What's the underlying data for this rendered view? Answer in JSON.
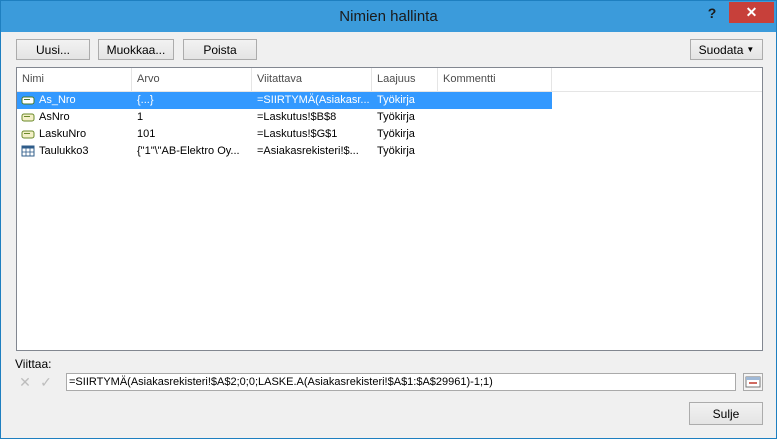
{
  "window": {
    "title": "Nimien hallinta",
    "help": "?",
    "close": "✕"
  },
  "toolbar": {
    "new": "Uusi...",
    "edit": "Muokkaa...",
    "delete": "Poista",
    "filter": "Suodata"
  },
  "table": {
    "columns": [
      "Nimi",
      "Arvo",
      "Viitattava",
      "Laajuus",
      "Kommentti"
    ],
    "rows": [
      {
        "name": "As_Nro",
        "value": "{...}",
        "ref": "=SIIRTYMÄ(Asiakasr...",
        "scope": "Työkirja",
        "comment": "",
        "icon": "named-range-icon"
      },
      {
        "name": "AsNro",
        "value": "1",
        "ref": "=Laskutus!$B$8",
        "scope": "Työkirja",
        "comment": "",
        "icon": "named-range-icon"
      },
      {
        "name": "LaskuNro",
        "value": "101",
        "ref": "=Laskutus!$G$1",
        "scope": "Työkirja",
        "comment": "",
        "icon": "named-range-icon"
      },
      {
        "name": "Taulukko3",
        "value": "{\"1\"\\\"AB-Elektro Oy...",
        "ref": "=Asiakasrekisteri!$...",
        "scope": "Työkirja",
        "comment": "",
        "icon": "table-icon"
      }
    ]
  },
  "refers": {
    "label": "Viittaa:",
    "formula": "=SIIRTYMÄ(Asiakasrekisteri!$A$2;0;0;LASKE.A(Asiakasrekisteri!$A$1:$A$29961)-1;1)"
  },
  "footer": {
    "close": "Sulje"
  },
  "colors": {
    "accent": "#3b9bdb",
    "selection": "#3399ff",
    "close": "#c7403a"
  }
}
